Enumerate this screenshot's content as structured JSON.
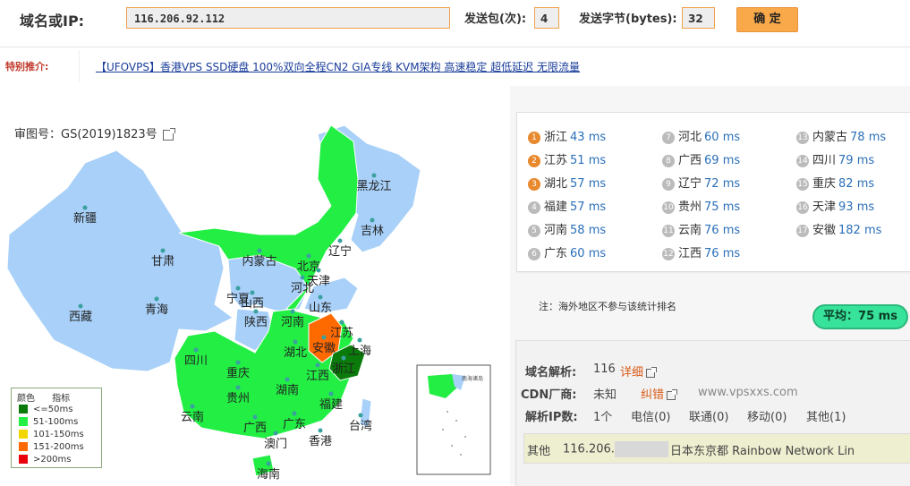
{
  "toolbar": {
    "domain_label": "域名或IP:",
    "domain_value": "116.206.92.112",
    "packets_label": "发送包(次):",
    "packets_value": "4",
    "bytes_label": "发送字节(bytes):",
    "bytes_value": "32",
    "confirm_label": "确 定"
  },
  "promo": {
    "label": "特别推介:",
    "link": "【UFOVPS】香港VPS SSD硬盘 100%双向全程CN2 GIA专线 KVM架构 高速稳定 超低延迟 无限流量"
  },
  "map": {
    "approval_no": "审图号：GS(2019)1823号",
    "provinces": [
      "黑龙江",
      "吉林",
      "辽宁",
      "内蒙古",
      "北京",
      "天津",
      "河北",
      "山东",
      "山西",
      "宁夏",
      "甘肃",
      "青海",
      "新疆",
      "西藏",
      "陕西",
      "河南",
      "江苏",
      "安徽",
      "上海",
      "湖北",
      "四川",
      "重庆",
      "浙江",
      "江西",
      "湖南",
      "贵州",
      "福建",
      "云南",
      "广西",
      "广东",
      "台湾",
      "澳门",
      "香港",
      "海南"
    ],
    "inset": {
      "top": "南海诸岛",
      "bottom": "南海诸岛"
    }
  },
  "legend": {
    "title_color": "颜色",
    "title_metric": "指标",
    "items": [
      {
        "label": "<=50ms",
        "color": "#0a7a0a"
      },
      {
        "label": "51-100ms",
        "color": "#22ee44"
      },
      {
        "label": "101-150ms",
        "color": "#f2d600"
      },
      {
        "label": "151-200ms",
        "color": "#ff6a00"
      },
      {
        "label": ">200ms",
        "color": "#e8000a"
      }
    ]
  },
  "ranking": [
    {
      "rank": "1",
      "name": "浙江",
      "ms": "43 ms"
    },
    {
      "rank": "2",
      "name": "江苏",
      "ms": "51 ms"
    },
    {
      "rank": "3",
      "name": "湖北",
      "ms": "57 ms"
    },
    {
      "rank": "4",
      "name": "福建",
      "ms": "57 ms"
    },
    {
      "rank": "5",
      "name": "河南",
      "ms": "58 ms"
    },
    {
      "rank": "6",
      "name": "广东",
      "ms": "60 ms"
    },
    {
      "rank": "7",
      "name": "河北",
      "ms": "60 ms"
    },
    {
      "rank": "8",
      "name": "广西",
      "ms": "69 ms"
    },
    {
      "rank": "9",
      "name": "辽宁",
      "ms": "72 ms"
    },
    {
      "rank": "10",
      "name": "贵州",
      "ms": "75 ms"
    },
    {
      "rank": "11",
      "name": "云南",
      "ms": "76 ms"
    },
    {
      "rank": "12",
      "name": "江西",
      "ms": "76 ms"
    },
    {
      "rank": "13",
      "name": "内蒙古",
      "ms": "78 ms"
    },
    {
      "rank": "14",
      "name": "四川",
      "ms": "79 ms"
    },
    {
      "rank": "15",
      "name": "重庆",
      "ms": "82 ms"
    },
    {
      "rank": "16",
      "name": "天津",
      "ms": "93 ms"
    },
    {
      "rank": "17",
      "name": "安徽",
      "ms": "182 ms"
    }
  ],
  "note": "注：海外地区不参与该统计排名",
  "average": "平均：75 ms",
  "dns": {
    "resolve_label": "域名解析:",
    "resolve_count": "116",
    "detail_link": "详细",
    "cdn_label": "CDN厂商:",
    "cdn_value": "未知",
    "correct_link": "纠错",
    "watermark": "www.vpsxxs.com",
    "ipcount_label": "解析IP数:",
    "ip_count": "1个",
    "telecom": "电信(0)",
    "unicom": "联通(0)",
    "mobile": "移动(0)",
    "other": "其他(1)",
    "row_type": "其他",
    "row_ip": "116.206.",
    "row_location": "日本东京都 Rainbow Network Lin"
  }
}
